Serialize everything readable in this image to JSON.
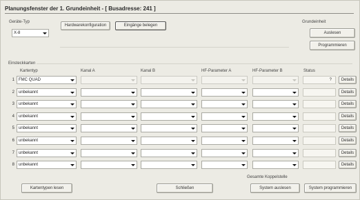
{
  "window": {
    "title": "Planungsfenster der 1. Grundeinheit - [ Busadresse: 241 ]"
  },
  "geraete_typ": {
    "label": "Geräte-Typ",
    "value": "X-8"
  },
  "toolbar": {
    "hardware_label": "Hardwarekonfiguration",
    "eingaenge_label": "Eingänge belegen"
  },
  "grundeinheit": {
    "label": "Grundeinheit",
    "auslesen": "Auslesen",
    "programmieren": "Programmieren"
  },
  "einsteckkarten": {
    "label": "Einsteckkarten",
    "headers": {
      "kartentyp": "Kartentyp",
      "kanal_a": "Kanal A",
      "kanal_b": "Kanal B",
      "hf_a": "HF-Parameter A",
      "hf_b": "HF-Parameter B",
      "status": "Status"
    },
    "rows": [
      {
        "num": "1",
        "kartentyp": "FMC QUAD",
        "status": "?",
        "details": "Details"
      },
      {
        "num": "2",
        "kartentyp": "unbekannt",
        "status": "",
        "details": "Details"
      },
      {
        "num": "3",
        "kartentyp": "unbekannt",
        "status": "",
        "details": "Details"
      },
      {
        "num": "4",
        "kartentyp": "unbekannt",
        "status": "",
        "details": "Details"
      },
      {
        "num": "5",
        "kartentyp": "unbekannt",
        "status": "",
        "details": "Details"
      },
      {
        "num": "6",
        "kartentyp": "unbekannt",
        "status": "",
        "details": "Details"
      },
      {
        "num": "7",
        "kartentyp": "unbekannt",
        "status": "",
        "details": "Details"
      },
      {
        "num": "8",
        "kartentyp": "unbekannt",
        "status": "",
        "details": "Details"
      }
    ]
  },
  "footer": {
    "kartentypen_lesen": "Kartentypen lesen",
    "schliessen": "Schließen",
    "gesamte_label": "Gesamte Koppelstelle",
    "system_auslesen": "System auslesen",
    "system_programmieren": "System programmieren"
  },
  "colors": {
    "background": "#ecebe4",
    "border": "#9b9b94",
    "text": "#333333"
  }
}
